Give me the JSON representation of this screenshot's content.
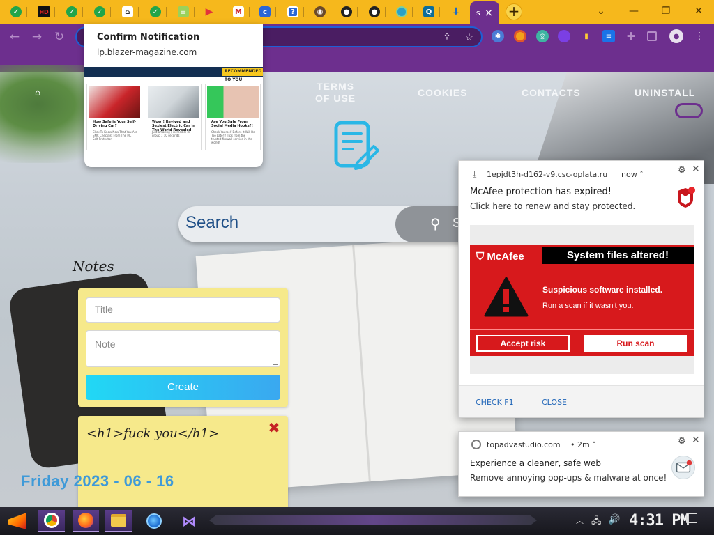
{
  "browser": {
    "tabs": [
      {
        "icon": "check-icon",
        "color": "#22a54a"
      },
      {
        "icon": "hd-icon",
        "color": "#d21f1f",
        "text": "HD"
      },
      {
        "icon": "check-icon",
        "color": "#22a54a"
      },
      {
        "icon": "check-icon",
        "color": "#22a54a"
      },
      {
        "icon": "home-icon",
        "color": "#ffffff"
      },
      {
        "icon": "check-icon",
        "color": "#22a54a"
      },
      {
        "icon": "document-icon",
        "color": "#7cc04a"
      },
      {
        "icon": "play-icon",
        "color": "#e2343a"
      },
      {
        "icon": "mcafee-shield-icon",
        "color": "#c8161d"
      },
      {
        "icon": "c-icon",
        "color": "#2b67d6",
        "text": "c"
      },
      {
        "icon": "question-icon",
        "color": "#2b67d6",
        "text": "?"
      },
      {
        "icon": "globe-icon",
        "color": "#6b4a2a"
      },
      {
        "icon": "github-icon",
        "color": "#222222"
      },
      {
        "icon": "github-icon",
        "color": "#222222"
      },
      {
        "icon": "circle-icon",
        "color": "#2ba0c8"
      },
      {
        "icon": "q-icon",
        "color": "#0d6d9a",
        "text": "Q"
      },
      {
        "icon": "download-icon",
        "color": "#1d6cc4"
      }
    ],
    "active_tab_close": "×",
    "new_tab_label": "+",
    "window_controls": {
      "dropdown": "⌄",
      "minimize": "—",
      "restore": "❐",
      "close": "✕"
    },
    "accent": "#6d2f8e"
  },
  "page": {
    "nav": {
      "terms_line1": "TERMS",
      "terms_line2": "OF USE",
      "cookies": "COOKIES",
      "contacts": "CONTACTS",
      "uninstall": "UNINSTALL"
    },
    "search": {
      "placeholder": "Search",
      "button_text": "S"
    },
    "notes": {
      "heading": "Notes",
      "title_placeholder": "Title",
      "note_placeholder": "Note",
      "create_label": "Create",
      "card_title": "<h1>fuck you</h1>",
      "delete_symbol": "✖"
    },
    "date": "Friday 2023 - 06 - 16"
  },
  "confirm_popup": {
    "title": "Confirm Notification",
    "site": "lp.blazer-magazine.com",
    "ribbon": "RECOMMENDED TO YOU",
    "cards": [
      {
        "headline": "How Safe is Your Self-Driving Car?",
        "text": "Click To Know Now That You Are EMC Checklist From The ML Self-Protector"
      },
      {
        "headline": "Wow!! Revived and Sexiest Electric Car In The World Revealed!",
        "text": "Just amazing / incredible in group 1 10 seconds"
      },
      {
        "headline": "Are You Safe From Social Media Hooks?!",
        "text": "Check Yourself Before It Will Be Too Late!!! Tips from the trusted firewall service in the world!"
      }
    ]
  },
  "mcafee_notification": {
    "source": "1epjdt3h-d162-v9.csc-oplata.ru",
    "time": "now",
    "headline": "McAfee protection has expired!",
    "body": "Click here to renew and stay protected.",
    "image": {
      "brand": "McAfee",
      "banner": "System files altered!",
      "warning_head": "Suspicious software installed.",
      "warning_body": "Run a scan if it wasn't you.",
      "accept_label": "Accept risk",
      "scan_label": "Run scan"
    },
    "action1": "CHECK F1",
    "action2": "CLOSE"
  },
  "topadva_notification": {
    "source": "topadvastudio.com",
    "time": "2m",
    "headline": "Experience a cleaner, safe web",
    "body": "Remove annoying pop-ups & malware at once!"
  },
  "taskbar": {
    "apps": [
      "start-button",
      "chrome-icon",
      "firefox-icon",
      "file-explorer-icon",
      "ie-icon",
      "visual-studio-icon"
    ],
    "clock": "4:31 PM"
  }
}
